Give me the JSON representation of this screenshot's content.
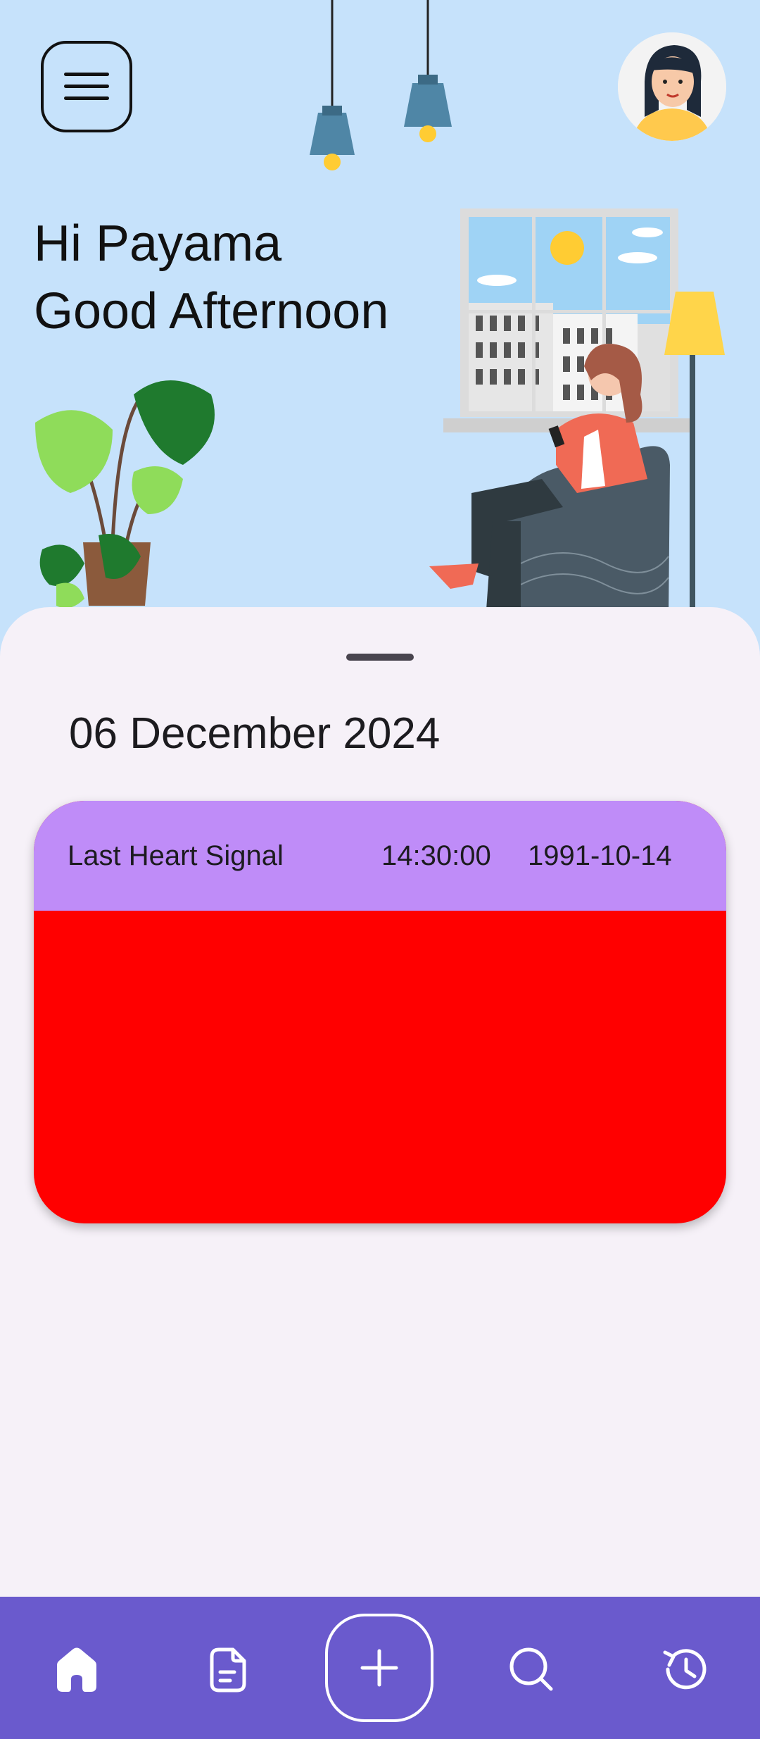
{
  "greeting": {
    "line1": "Hi Payama",
    "line2": "Good Afternoon"
  },
  "header": {
    "menu_icon": "menu-icon",
    "avatar_icon": "avatar-woman"
  },
  "sheet": {
    "date": "06 December 2024"
  },
  "card": {
    "label": "Last Heart Signal",
    "time": "14:30:00",
    "date": "1991-10-14",
    "header_color": "#bf8cf8",
    "body_color": "#ff0000"
  },
  "nav": {
    "items": [
      {
        "icon": "home-icon"
      },
      {
        "icon": "document-icon"
      },
      {
        "icon": "add-icon"
      },
      {
        "icon": "search-icon"
      },
      {
        "icon": "history-icon"
      }
    ],
    "background": "#6a5acd"
  }
}
